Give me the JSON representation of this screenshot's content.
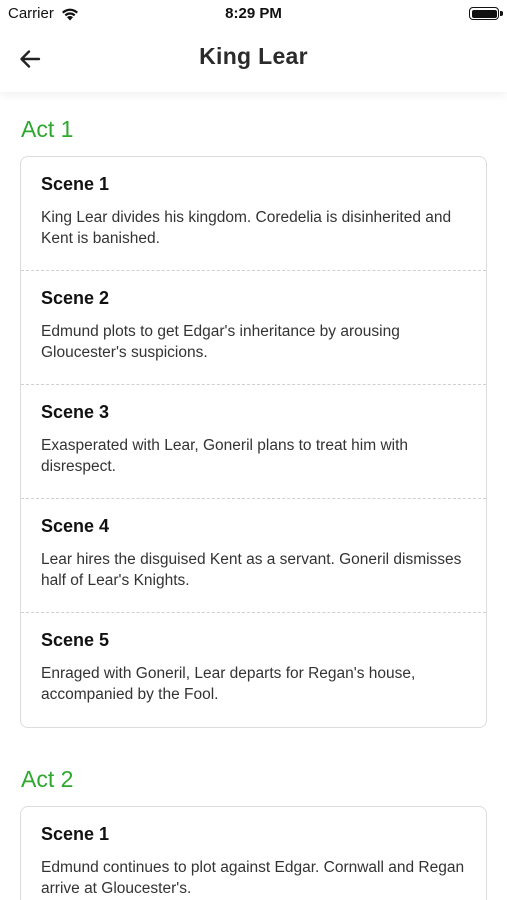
{
  "status_bar": {
    "carrier": "Carrier",
    "time": "8:29 PM",
    "icons": [
      "wifi-icon",
      "battery-icon"
    ]
  },
  "header": {
    "title": "King Lear",
    "back_icon": "arrow-left-icon"
  },
  "colors": {
    "act_title": "#2ea82e",
    "card_border": "#dcdcdc",
    "divider": "#d0d0d0"
  },
  "acts": [
    {
      "title": "Act 1",
      "scenes": [
        {
          "title": "Scene 1",
          "description": "King Lear divides his kingdom. Coredelia is disinherited and Kent is banished."
        },
        {
          "title": "Scene 2",
          "description": "Edmund plots to get Edgar's inheritance by arousing Gloucester's suspicions."
        },
        {
          "title": "Scene 3",
          "description": "Exasperated with Lear, Goneril plans to treat him with disrespect."
        },
        {
          "title": "Scene 4",
          "description": "Lear hires the disguised Kent as a servant. Goneril dismisses half of Lear's Knights."
        },
        {
          "title": "Scene 5",
          "description": "Enraged with Goneril, Lear departs for Regan's house, accompanied by the Fool."
        }
      ]
    },
    {
      "title": "Act 2",
      "scenes": [
        {
          "title": "Scene 1",
          "description": "Edmund continues to plot against Edgar. Cornwall and Regan arrive at Gloucester's."
        }
      ]
    }
  ]
}
